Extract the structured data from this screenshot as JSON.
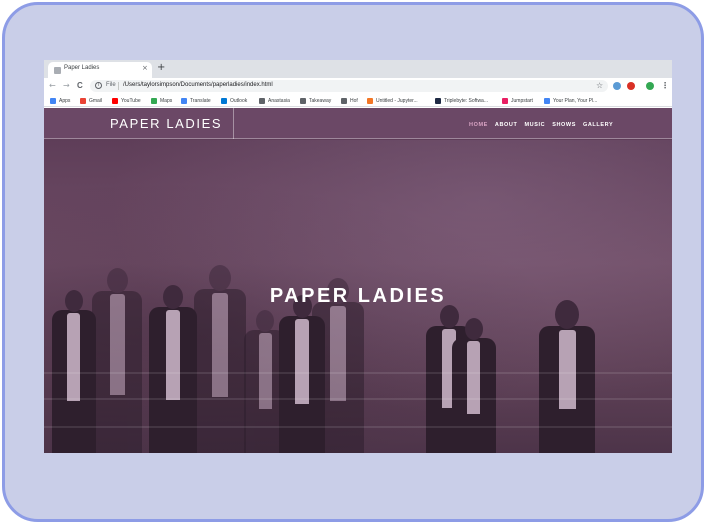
{
  "browser": {
    "tab": {
      "title": "Paper Ladies",
      "close": "×"
    },
    "new_tab": "+",
    "nav": {
      "back": "←",
      "forward": "→",
      "reload": "C"
    },
    "address": {
      "scheme": "File",
      "url": "/Users/taylorsimpson/Documents/paperladies/index.html"
    },
    "icons": {
      "star": "☆",
      "menu": "⋮",
      "info": "i"
    },
    "bookmarks": [
      {
        "label": "Apps",
        "color": "#4285f4"
      },
      {
        "label": "Gmail",
        "color": "#ea4335"
      },
      {
        "label": "YouTube",
        "color": "#ff0000"
      },
      {
        "label": "Maps",
        "color": "#34a853"
      },
      {
        "label": "Translate",
        "color": "#4285f4"
      },
      {
        "label": "Outlook",
        "color": "#0078d4"
      },
      {
        "label": "Anastasia",
        "color": "#5f6368"
      },
      {
        "label": "Takeaway",
        "color": "#5f6368"
      },
      {
        "label": "Hof",
        "color": "#5f6368"
      },
      {
        "label": "Untitled - Jupyter...",
        "color": "#f37726"
      },
      {
        "label": "Triplebyte: Softwa...",
        "color": "#1f2a44"
      },
      {
        "label": "Jumpstart",
        "color": "#e91e63"
      },
      {
        "label": "Your Plan, Your Pl...",
        "color": "#4285f4"
      }
    ],
    "extensions": [
      "#5b9bd5",
      "#d93025",
      "#34a853"
    ]
  },
  "site": {
    "brand": "PAPER LADIES",
    "nav": [
      {
        "label": "HOME",
        "active": true
      },
      {
        "label": "ABOUT",
        "active": false
      },
      {
        "label": "MUSIC",
        "active": false
      },
      {
        "label": "SHOWS",
        "active": false
      },
      {
        "label": "GALLERY",
        "active": false
      }
    ],
    "hero_title": "PAPER LADIES"
  }
}
